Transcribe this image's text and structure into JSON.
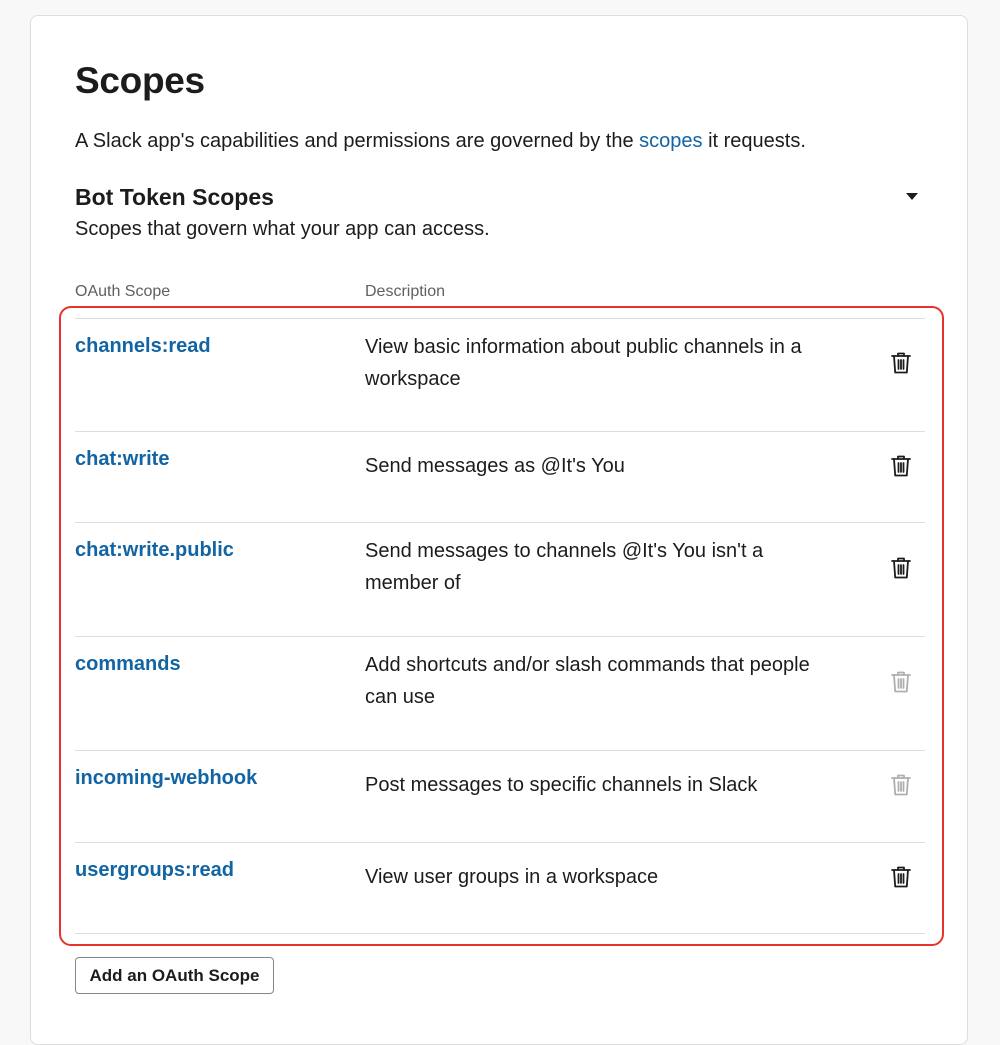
{
  "page": {
    "title": "Scopes",
    "intro_before": "A Slack app's capabilities and permissions are governed by the ",
    "intro_link": "scopes",
    "intro_after": " it requests."
  },
  "section": {
    "title": "Bot Token Scopes",
    "subtitle": "Scopes that govern what your app can access.",
    "toggle_icon": "caret-down-icon"
  },
  "table": {
    "headers": [
      "OAuth Scope",
      "Description"
    ],
    "rows": [
      {
        "scope": "channels:read",
        "description": "View basic information about public channels in a workspace",
        "removable": true
      },
      {
        "scope": "chat:write",
        "description": "Send messages as @It's You",
        "removable": true
      },
      {
        "scope": "chat:write.public",
        "description": "Send messages to channels @It's You isn't a member of",
        "removable": true
      },
      {
        "scope": "commands",
        "description": "Add shortcuts and/or slash commands that people can use",
        "removable": false
      },
      {
        "scope": "incoming-webhook",
        "description": "Post messages to specific channels in Slack",
        "removable": false
      },
      {
        "scope": "usergroups:read",
        "description": "View user groups in a workspace",
        "removable": true
      }
    ]
  },
  "actions": {
    "add_scope_label": "Add an OAuth Scope"
  },
  "colors": {
    "link": "#1264a3",
    "highlight": "#e8322b",
    "text": "#1d1c1d",
    "muted": "#616061"
  },
  "icons": {
    "remove": "trash-icon"
  }
}
